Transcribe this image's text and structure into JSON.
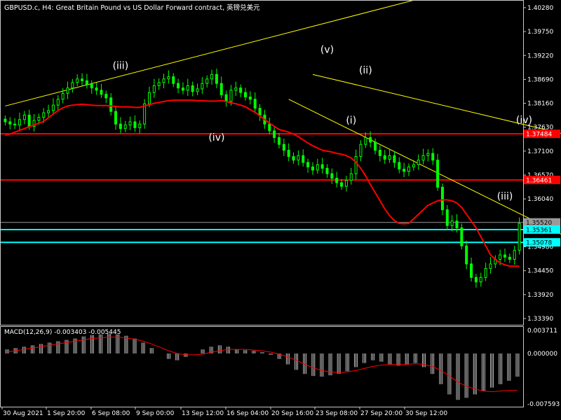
{
  "header": {
    "title": "GBPUSD.c, H4:  Great Britain Pound vs US Dollar Forward contract, 英镑兑美元"
  },
  "colors": {
    "background": "#000000",
    "bull": "#00ff00",
    "bear": "#00ff00",
    "ma": "#ff0000",
    "trend": "#ffff00",
    "hline_red": "#ff0000",
    "hline_cyan": "#00ffff",
    "price_line": "#9a9a9a",
    "wave_label": "#ffffff",
    "arrow": "#00bfff",
    "macd_hist": "#c0c0c0",
    "macd_signal": "#ff0000"
  },
  "chart_data": [
    {
      "type": "candlestick",
      "symbol": "GBPUSD.c",
      "timeframe": "H4",
      "ylim": [
        1.3325,
        1.4045
      ],
      "y_ticks": [
        "1.40280",
        "1.39750",
        "1.39220",
        "1.38690",
        "1.38160",
        "1.37630",
        "1.37100",
        "1.36570",
        "1.36040",
        "1.35520",
        "1.34980",
        "1.34450",
        "1.33920",
        "1.33390"
      ],
      "x_ticks": [
        "30 Aug 2021",
        "1 Sep 20:00",
        "6 Sep 08:00",
        "9 Sep 00:00",
        "13 Sep 12:00",
        "16 Sep 04:00",
        "20 Sep 16:00",
        "23 Sep 08:00",
        "27 Sep 20:00",
        "30 Sep 12:00"
      ],
      "close": [
        1.3775,
        1.377,
        1.3768,
        1.378,
        1.379,
        1.3765,
        1.3778,
        1.3785,
        1.3795,
        1.38,
        1.3812,
        1.3825,
        1.3838,
        1.385,
        1.3862,
        1.387,
        1.3866,
        1.3858,
        1.385,
        1.3845,
        1.3836,
        1.3828,
        1.3798,
        1.377,
        1.376,
        1.3768,
        1.3775,
        1.3762,
        1.377,
        1.3815,
        1.384,
        1.3855,
        1.3862,
        1.387,
        1.3875,
        1.386,
        1.385,
        1.3845,
        1.3855,
        1.3842,
        1.3848,
        1.386,
        1.387,
        1.388,
        1.386,
        1.3835,
        1.382,
        1.3845,
        1.385,
        1.384,
        1.383,
        1.3825,
        1.3805,
        1.379,
        1.377,
        1.3755,
        1.374,
        1.3725,
        1.3712,
        1.3698,
        1.369,
        1.37,
        1.3685,
        1.3675,
        1.3668,
        1.368,
        1.3672,
        1.366,
        1.365,
        1.364,
        1.3632,
        1.3645,
        1.366,
        1.3698,
        1.3725,
        1.374,
        1.373,
        1.3712,
        1.37,
        1.3692,
        1.37,
        1.3685,
        1.367,
        1.3665,
        1.3675,
        1.368,
        1.369,
        1.37,
        1.3705,
        1.369,
        1.363,
        1.358,
        1.3545,
        1.3555,
        1.354,
        1.35,
        1.346,
        1.343,
        1.342,
        1.343,
        1.345,
        1.346,
        1.347,
        1.348,
        1.3475,
        1.347,
        1.349,
        1.355
      ],
      "series": [
        {
          "name": "MA",
          "values": [
            1.3745,
            1.3748,
            1.3752,
            1.3756,
            1.376,
            1.3764,
            1.3768,
            1.3772,
            1.3776,
            1.3784,
            1.3792,
            1.38,
            1.3806,
            1.381,
            1.3812,
            1.3813,
            1.3814,
            1.3813,
            1.3812,
            1.3811,
            1.3811,
            1.3811,
            1.381,
            1.3809,
            1.3808,
            1.3808,
            1.3808,
            1.3807,
            1.3807,
            1.381,
            1.3813,
            1.3816,
            1.3818,
            1.382,
            1.3822,
            1.3823,
            1.3823,
            1.3823,
            1.3823,
            1.3823,
            1.3822,
            1.3822,
            1.3821,
            1.3821,
            1.3821,
            1.3822,
            1.382,
            1.3817,
            1.3815,
            1.3812,
            1.3808,
            1.3802,
            1.3796,
            1.3788,
            1.378,
            1.3772,
            1.3765,
            1.3758,
            1.3755,
            1.3752,
            1.3748,
            1.3742,
            1.3735,
            1.3728,
            1.3722,
            1.3717,
            1.3712,
            1.371,
            1.3708,
            1.3705,
            1.3703,
            1.37,
            1.3695,
            1.3685,
            1.3672,
            1.3655,
            1.3636,
            1.3618,
            1.36,
            1.3582,
            1.3567,
            1.3556,
            1.355,
            1.3549,
            1.355,
            1.356,
            1.357,
            1.358,
            1.359,
            1.3595,
            1.36,
            1.3602,
            1.3602,
            1.36,
            1.3595,
            1.3585,
            1.357,
            1.3555,
            1.354,
            1.352,
            1.35,
            1.348,
            1.347,
            1.3462,
            1.3458,
            1.3455,
            1.3455,
            1.3455
          ]
        }
      ],
      "price_labels": [
        {
          "text": "1.37484",
          "price": 1.37484,
          "color": "#ff0000"
        },
        {
          "text": "1.36461",
          "price": 1.36461,
          "color": "#ff0000"
        },
        {
          "text": "1.35520",
          "price": 1.3552,
          "color": "#9a9a9a"
        },
        {
          "text": "1.35361",
          "price": 1.35361,
          "color": "#00ffff"
        },
        {
          "text": "1.35078",
          "price": 1.35078,
          "color": "#00ffff"
        }
      ],
      "wave_labels": [
        {
          "text": "(iii)",
          "idx": 24,
          "price": 1.3892
        },
        {
          "text": "(iv)",
          "idx": 44,
          "price": 1.3733
        },
        {
          "text": "(v)",
          "idx": 67,
          "price": 1.3928
        },
        {
          "text": "(ii)",
          "idx": 75,
          "price": 1.3882
        },
        {
          "text": "(i)",
          "idx": 72,
          "price": 1.3771
        },
        {
          "text": "(iv)",
          "idx": 108,
          "price": 1.3772
        },
        {
          "text": "(iii)",
          "idx": 104,
          "price": 1.3603
        },
        {
          "text": "(v)",
          "idx": 163,
          "price": 1.3745
        },
        {
          "text": "(iii)",
          "idx": 149,
          "price": 1.3655
        },
        {
          "text": "(iv)",
          "idx": 158,
          "price": 1.3583
        },
        {
          "text": "(i)",
          "idx": 139,
          "price": 1.3492
        },
        {
          "text": "(ii)",
          "idx": 143,
          "price": 1.3428
        },
        {
          "text": "(v)",
          "idx": 134,
          "price": 1.3402
        }
      ],
      "trend_lines": [
        {
          "from": [
            0,
            1.381
          ],
          "to": [
            87,
            1.405
          ]
        },
        {
          "from": [
            64,
            1.388
          ],
          "to": [
            157,
            1.3645
          ]
        },
        {
          "from": [
            59,
            1.3825
          ],
          "to": [
            150,
            1.3345
          ]
        },
        {
          "from": [
            134,
            1.341
          ],
          "to": [
            178,
            1.358
          ]
        }
      ],
      "arrow": {
        "idx": 151,
        "price": 1.3588,
        "direction": "up"
      }
    },
    {
      "type": "histogram",
      "title": "MACD(12,26,9) -0.003403 -0.005445",
      "ylim": [
        -0.0078,
        0.004
      ],
      "y_ticks": [
        "0.003711",
        "0.000000",
        "-0.007593"
      ],
      "macd": [
        0.0006,
        0.0008,
        0.001,
        0.0012,
        0.0014,
        0.0016,
        0.0018,
        0.002,
        0.0022,
        0.0025,
        0.0027,
        0.0028,
        0.0029,
        0.0028,
        0.0026,
        0.0022,
        0.0016,
        0.0008,
        0.0,
        -0.0008,
        -0.001,
        -0.0005,
        0.0,
        0.0006,
        0.001,
        0.0012,
        0.001,
        0.0006,
        0.0005,
        0.0004,
        0.0002,
        -0.0002,
        -0.0008,
        -0.0016,
        -0.0024,
        -0.003,
        -0.0033,
        -0.0034,
        -0.0032,
        -0.003,
        -0.0026,
        -0.002,
        -0.0014,
        -0.001,
        -0.0012,
        -0.0016,
        -0.0018,
        -0.0016,
        -0.0014,
        -0.002,
        -0.003,
        -0.0045,
        -0.006,
        -0.0068,
        -0.0065,
        -0.006,
        -0.0055,
        -0.005,
        -0.0045,
        -0.004,
        -0.0034
      ],
      "signal": [
        0.0002,
        0.0004,
        0.0006,
        0.0008,
        0.001,
        0.0012,
        0.0014,
        0.0016,
        0.0018,
        0.002,
        0.0022,
        0.0023,
        0.0024,
        0.0024,
        0.0023,
        0.0021,
        0.0018,
        0.0014,
        0.0009,
        0.0004,
        0.0,
        -0.0002,
        -0.0002,
        -0.0001,
        0.0002,
        0.0004,
        0.0006,
        0.0006,
        0.0006,
        0.0005,
        0.0004,
        0.0002,
        -0.0001,
        -0.0005,
        -0.001,
        -0.0016,
        -0.0021,
        -0.0025,
        -0.0027,
        -0.0028,
        -0.0027,
        -0.0025,
        -0.0022,
        -0.0019,
        -0.0017,
        -0.0016,
        -0.0016,
        -0.0016,
        -0.0015,
        -0.0016,
        -0.0019,
        -0.0025,
        -0.0033,
        -0.0042,
        -0.0048,
        -0.0052,
        -0.0055,
        -0.0056,
        -0.0055,
        -0.0054,
        -0.0054
      ]
    }
  ]
}
